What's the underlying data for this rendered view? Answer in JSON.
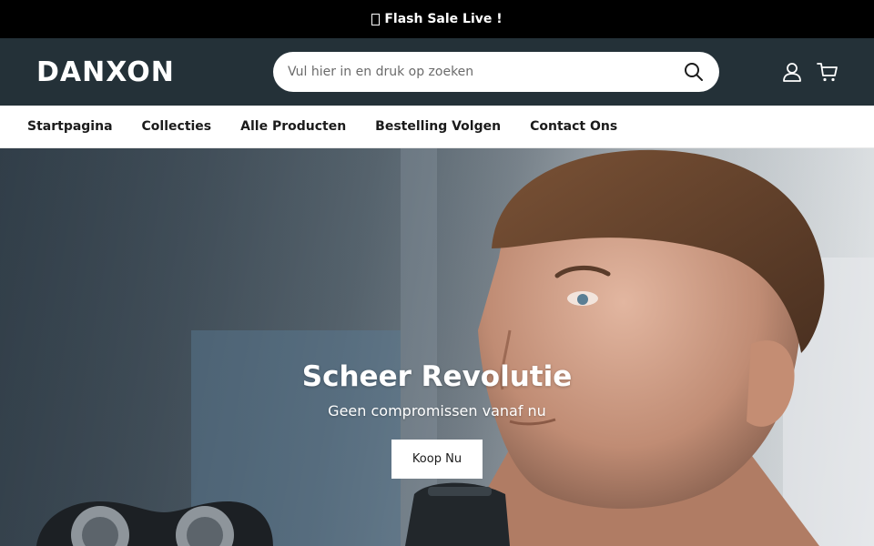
{
  "announcement": {
    "text": "Flash Sale Live !",
    "icon": "unrendered-glyph-box"
  },
  "header": {
    "logo_text": "DANXON",
    "search": {
      "placeholder": "Vul hier in en druk op zoeken",
      "value": ""
    },
    "icons": [
      "search-icon",
      "account-icon",
      "cart-icon"
    ]
  },
  "nav": {
    "items": [
      {
        "label": "Startpagina"
      },
      {
        "label": "Collecties"
      },
      {
        "label": "Alle Producten"
      },
      {
        "label": "Bestelling Volgen"
      },
      {
        "label": "Contact Ons"
      }
    ]
  },
  "hero": {
    "title": "Scheer Revolutie",
    "subtitle": "Geen compromissen vanaf nu",
    "cta_label": "Koop Nu"
  },
  "colors": {
    "announcement_bg": "#000000",
    "header_bg": "#243138",
    "nav_bg": "#ffffff",
    "text_dark": "#1b1b1b"
  }
}
